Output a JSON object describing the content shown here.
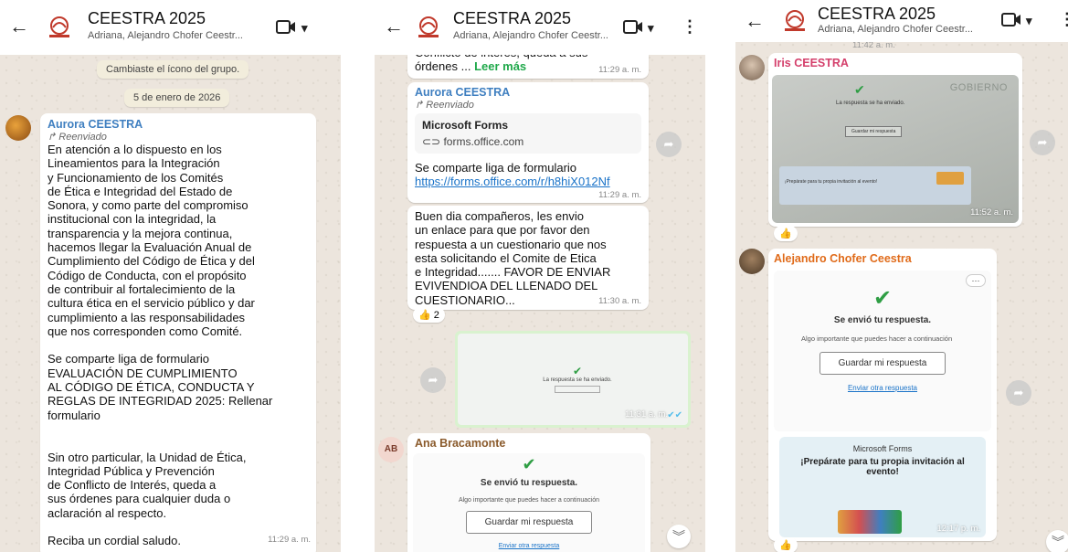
{
  "group": {
    "title": "CEESTRA 2025",
    "members": "Adriana, Alejandro Chofer Ceestr..."
  },
  "icons": {
    "back": "←",
    "video": "video-call-icon",
    "dropdown": "▾",
    "menu": "⋮",
    "forward": "forward-icon",
    "scroll_down": "︾",
    "thumbs_up": "👍"
  },
  "colors": {
    "sender_aurora": "#3f7fc0",
    "sender_iris": "#d43f6b",
    "sender_alejandro": "#e06b1a",
    "sender_ana": "#8a5a2b",
    "wallpaper": "#ece5dd",
    "link": "#1a73c8",
    "read_ticks": "#53bdeb"
  },
  "panel1": {
    "system_msg": "Cambiaste el ícono del grupo.",
    "date_chip": "5 de enero de 2026",
    "message": {
      "sender": "Aurora CEESTRA",
      "forwarded": "Reenviado",
      "body": "En atención a lo dispuesto en los\nLineamientos para la Integración\ny Funcionamiento de los Comités\nde Ética e Integridad del Estado de\nSonora, y como parte del compromiso\ninstitucional con la integridad, la\ntransparencia y la mejora continua,\nhacemos llegar la Evaluación Anual de\nCumplimiento del Código de Ética y del\nCódigo de Conducta, con el propósito\nde contribuir al fortalecimiento de la\ncultura ética en el servicio público y dar\ncumplimiento a las responsabilidades\nque nos corresponden como Comité.\n\nSe comparte liga de formulario\nEVALUACIÓN DE CUMPLIMIENTO\nAL CÓDIGO DE ÉTICA, CONDUCTA Y\nREGLAS DE INTEGRIDAD 2025: Rellenar\nformulario\n\n\nSin otro particular, la Unidad de Ética,\nIntegridad Pública y Prevención\nde Conflicto de Interés, queda a\nsus órdenes para cualquier duda o\naclaración al respecto.\n\nReciba un cordial saludo.",
      "time": "11:29 a. m."
    }
  },
  "panel2": {
    "top_msg": {
      "text": "Conflicto de interés, queda a sus\nórdenes ...",
      "read_more": "Leer más",
      "time": "11:29 a. m."
    },
    "link_msg": {
      "sender": "Aurora CEESTRA",
      "forwarded": "Reenviado",
      "card_title": "Microsoft Forms",
      "card_domain": "forms.office.com",
      "text": "Se comparte liga de formulario",
      "url": "https://forms.office.com/r/h8hiX012Nf",
      "time": "11:29 a. m."
    },
    "text_msg": {
      "body": "Buen dia compañeros, les envio\nun enlace para que por favor den\nrespuesta a un cuestionario que nos\nesta solicitando el Comite de Etica\ne Integridad....... FAVOR DE ENVIAR\nEVIVENDIOA DEL LLENADO DEL\nCUESTIONARIO...",
      "time": "11:30 a. m.",
      "reaction": "👍 2"
    },
    "image_msg": {
      "caption": "La respuesta se ha enviado.",
      "time": "11:31 a. m."
    },
    "ana_msg": {
      "avatar_initials": "AB",
      "sender": "Ana Bracamonte",
      "form_title": "Se envió tu respuesta.",
      "form_sub": "Algo importante que puedes hacer a continuación",
      "save_btn": "Guardar mi respuesta",
      "other_link": "Enviar otra respuesta"
    }
  },
  "panel3": {
    "top_time": "11:42 a. m.",
    "iris_msg": {
      "sender": "Iris CEESTRA",
      "photo_caption": "La respuesta se ha enviado.",
      "photo_button": "Guardar mi respuesta",
      "photo_banner": "¡Prepárate para tu propia invitación al evento!",
      "photo_brand": "GOBIERNO",
      "time": "11:52 a. m.",
      "reaction": "👍"
    },
    "alejandro_msg": {
      "sender": "Alejandro Chofer Ceestra",
      "more": "···",
      "form_title": "Se envió tu respuesta.",
      "form_sub": "Algo importante que puedes hacer a continuación",
      "save_btn": "Guardar mi respuesta",
      "other_link": "Enviar otra respuesta",
      "promo_brand": "Microsoft Forms",
      "promo_text": "¡Prepárate para tu propia invitación al evento!",
      "time": "12:17 p. m.",
      "reaction": "👍"
    }
  }
}
